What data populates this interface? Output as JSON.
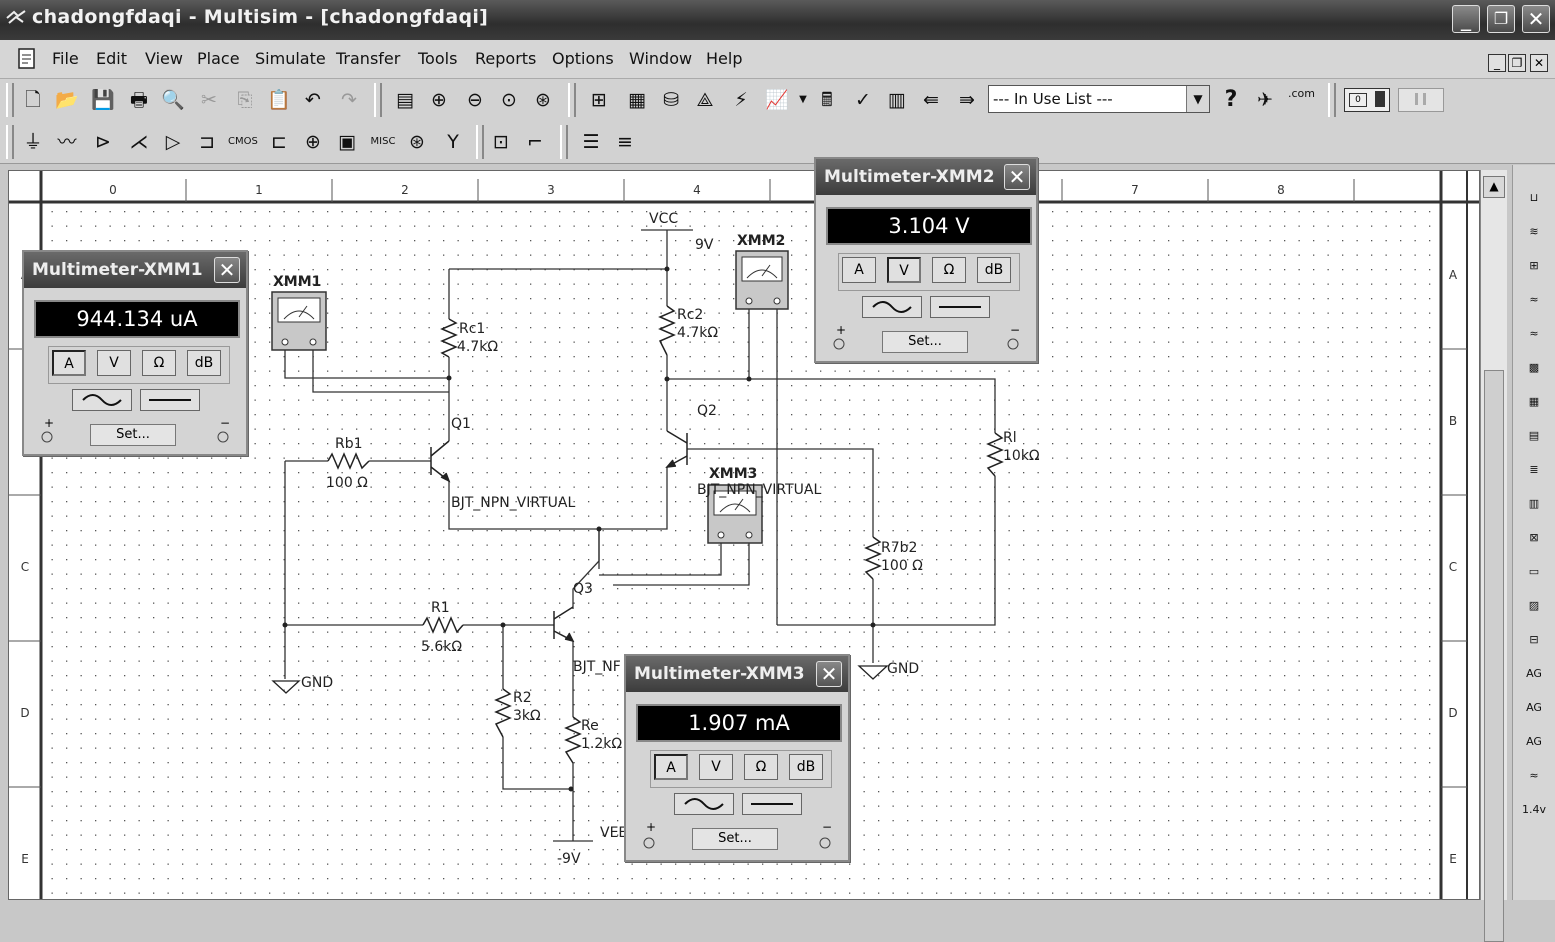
{
  "window": {
    "title": "chadongfdaqi - Multisim - [chadongfdaqi]",
    "minimize": "_",
    "restore": "❐",
    "close": "✕"
  },
  "menu": [
    {
      "label": "File"
    },
    {
      "label": "Edit"
    },
    {
      "label": "View"
    },
    {
      "label": "Place"
    },
    {
      "label": "Simulate"
    },
    {
      "label": "Transfer"
    },
    {
      "label": "Tools"
    },
    {
      "label": "Reports"
    },
    {
      "label": "Options"
    },
    {
      "label": "Window"
    },
    {
      "label": "Help"
    }
  ],
  "toolbar": {
    "in_use_list": "--- In Use List ---",
    "help_icon": "?",
    "com_label": ".com"
  },
  "toolbar2": {
    "misc_label": "MISC"
  },
  "ruler": {
    "columns": [
      "0",
      "1",
      "2",
      "3",
      "4",
      "5",
      "6",
      "7",
      "8"
    ],
    "rows": [
      "A",
      "B",
      "C",
      "D",
      "E"
    ]
  },
  "schematic": {
    "vcc_label": "VCC",
    "vcc_value": "9V",
    "vee_label": "VEE",
    "vee_value": "-9V",
    "gnd1": "GND",
    "gnd2": "GND",
    "rc1_name": "Rc1",
    "rc1_value": "4.7kΩ",
    "rc2_name": "Rc2",
    "rc2_value": "4.7kΩ",
    "rb1_name": "Rb1",
    "rb1_value": "100 Ω",
    "rl_name": "Rl",
    "rl_value": "10kΩ",
    "r7b2_name": "R7b2",
    "r7b2_value": "100 Ω",
    "r1_name": "R1",
    "r1_value": "5.6kΩ",
    "r2_name": "R2",
    "r2_value": "3kΩ",
    "re_name": "Re",
    "re_value": "1.2kΩ",
    "q1_name": "Q1",
    "q1_model": "BJT_NPN_VIRTUAL",
    "q2_name": "Q2",
    "q2_model": "BJT_NPN_VIRTUAL",
    "q3_name": "Q3",
    "q3_model": "BJT_NF",
    "xmm1_label": "XMM1",
    "xmm2_label": "XMM2",
    "xmm3_label": "XMM3"
  },
  "multimeters": [
    {
      "title": "Multimeter-XMM1",
      "reading": "944.134 uA",
      "active_mode": "A"
    },
    {
      "title": "Multimeter-XMM2",
      "reading": "3.104 V",
      "active_mode": "V"
    },
    {
      "title": "Multimeter-XMM3",
      "reading": "1.907 mA",
      "active_mode": "A"
    }
  ],
  "meter_buttons": {
    "a": "A",
    "v": "V",
    "ohm": "Ω",
    "db": "dB",
    "set": "Set...",
    "plus": "+",
    "minus": "−"
  }
}
